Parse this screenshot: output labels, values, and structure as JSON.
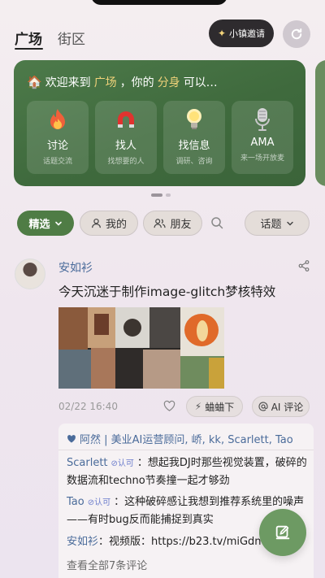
{
  "header": {
    "tabs": [
      {
        "label": "广场"
      },
      {
        "label": "街区"
      }
    ],
    "invite_label": "小镇邀请"
  },
  "banner": {
    "title_prefix": "欢迎来到",
    "title_place": "广场",
    "title_mid": "，你的",
    "title_self": "分身",
    "title_suffix": "可以…",
    "cards": [
      {
        "label": "讨论",
        "sub": "话题交流",
        "icon": "fire-icon"
      },
      {
        "label": "找人",
        "sub": "找想要的人",
        "icon": "magnet-icon"
      },
      {
        "label": "找信息",
        "sub": "调研、咨询",
        "icon": "lightbulb-icon"
      },
      {
        "label": "AMA",
        "sub": "来一场开放麦",
        "icon": "microphone-icon"
      }
    ]
  },
  "filters": {
    "selected": "精选",
    "mine": "我的",
    "friends": "朋友",
    "topic": "话题"
  },
  "post": {
    "author": "安如衫",
    "text": "今天沉迷于制作image-glitch梦核特效",
    "time": "02/22 16:40",
    "action_1": "蛐蛐下",
    "action_2": "AI 评论",
    "likes": "阿然 | 美业AI运营顾问, 峤, kk, Scarlett, Tao",
    "comments": [
      {
        "name": "Scarlett",
        "badge": "认可",
        "text": "：想起我DJ时那些视觉装置，破碎的数据流和techno节奏撞一起才够劲"
      },
      {
        "name": "Tao",
        "badge": "认可",
        "text": "：这种破碎感让我想到推荐系统里的噪声——有时bug反而能捕捉到真实"
      },
      {
        "name": "安如衫",
        "badge": "",
        "text": "：视频版：https://b23.tv/miGdn"
      }
    ],
    "view_all": "查看全部7条评论"
  },
  "colors": {
    "accent_green": "#4f7c45",
    "banner_green": "#3f6a3d",
    "link_blue": "#4a6b9a",
    "fab_green": "#6d9a63"
  }
}
